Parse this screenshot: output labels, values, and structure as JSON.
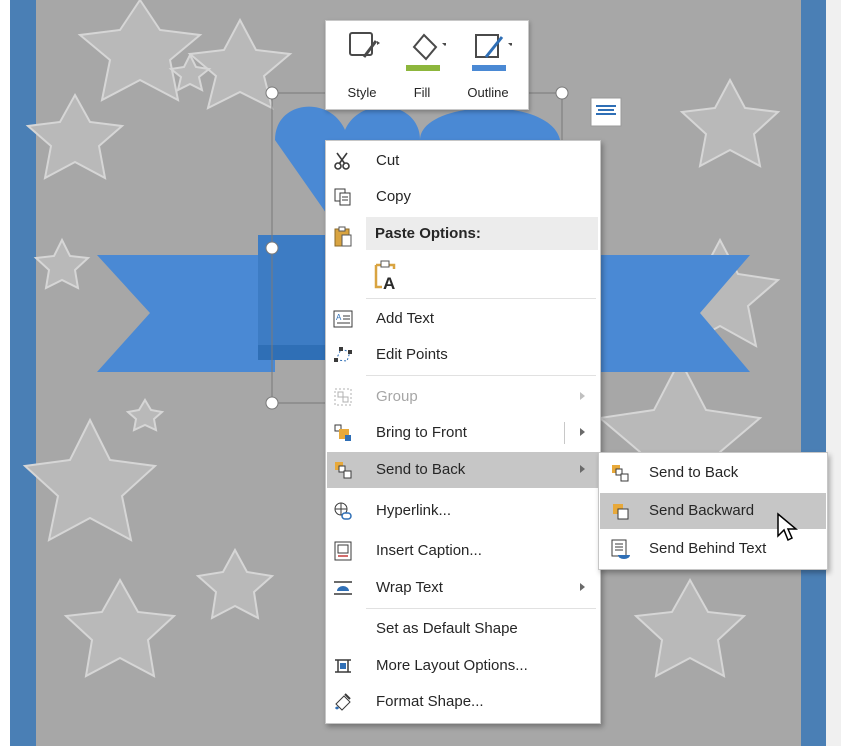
{
  "mini_toolbar": {
    "style_label": "Style",
    "fill_label": "Fill",
    "outline_label": "Outline"
  },
  "context_menu": {
    "cut": "Cut",
    "copy": "Copy",
    "paste_options": "Paste Options:",
    "add_text": "Add Text",
    "edit_points": "Edit Points",
    "group": "Group",
    "bring_to_front": "Bring to Front",
    "send_to_back": "Send to Back",
    "hyperlink": "Hyperlink...",
    "insert_caption": "Insert Caption...",
    "wrap_text": "Wrap Text",
    "set_default_shape": "Set as Default Shape",
    "more_layout_options": "More Layout Options...",
    "format_shape": "Format Shape..."
  },
  "submenu": {
    "send_to_back": "Send to Back",
    "send_backward": "Send Backward",
    "send_behind_text": "Send Behind Text"
  },
  "colors": {
    "border_blue": "#4a7fb5",
    "page_gray": "#a8a8a8",
    "shape_blue": "#4a89d4",
    "shape_dark_blue": "#2f6fb6",
    "fill_bar": "#8db63c",
    "outline_bar": "#4a89d4"
  },
  "icons": {
    "cut": "scissors-icon",
    "copy": "copy-icon",
    "paste": "clipboard-icon",
    "add_text": "add-text-icon",
    "edit_points": "edit-points-icon",
    "group": "group-icon",
    "bring_to_front": "bring-to-front-icon",
    "send_to_back": "send-to-back-icon",
    "hyperlink": "hyperlink-icon",
    "insert_caption": "caption-icon",
    "wrap_text": "wrap-text-icon",
    "more_layout": "layout-options-icon",
    "format_shape": "format-shape-icon",
    "cursor": "mouse-pointer-icon"
  }
}
